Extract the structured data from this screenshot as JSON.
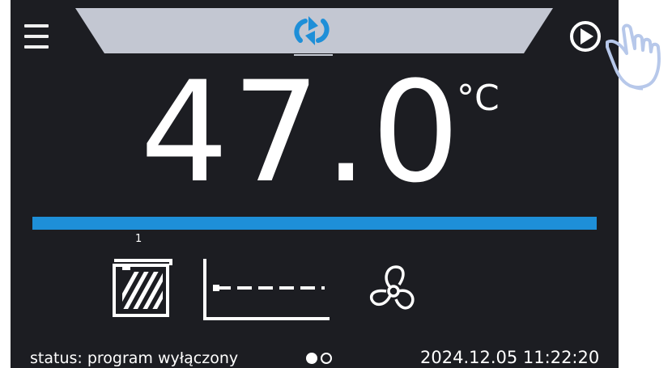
{
  "colors": {
    "screen_background": "#1c1d22",
    "top_tab": "#c3c7d2",
    "accent_blue": "#1e8fd8",
    "mode_icon": "#1e8fd8",
    "text": "#ffffff",
    "hand_outline": "#b7c8ea"
  },
  "header": {
    "menu_icon": "hamburger-menu-icon",
    "mode_icon": "program-cycle-icon",
    "play_icon": "play-icon"
  },
  "temperature": {
    "value": "47.0",
    "unit": "°C"
  },
  "progress": {
    "fraction": 1.0
  },
  "indicators": {
    "heater_step_number": "1",
    "heater_icon": "heating-element-icon",
    "graph_icon": "temperature-graph-icon",
    "fan_icon": "fan-icon"
  },
  "footer": {
    "status": "status: program wyłączony",
    "pages": 2,
    "active_page": 1,
    "datetime": "2024.12.05  11:22:20"
  },
  "overlay": {
    "hand_icon": "pointing-hand-icon"
  }
}
